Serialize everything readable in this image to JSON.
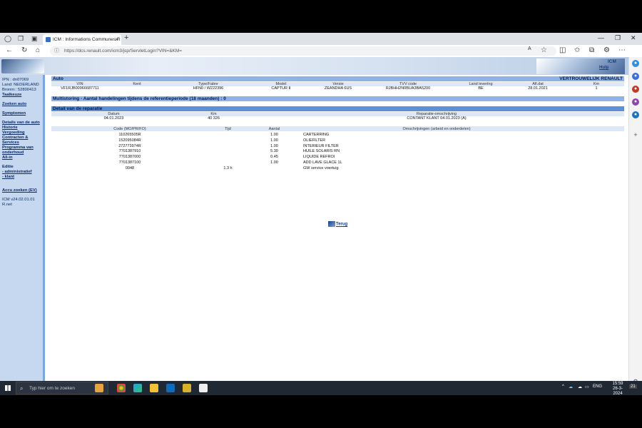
{
  "browser": {
    "tab_title": "ICM : Informations Communes R",
    "tab_close": "×",
    "new_tab": "+",
    "url": "https://dcs.renault.com/icm3/jsp/ServletLogin?VIN=&KM="
  },
  "header": {
    "icm": "ICM",
    "hulp": "Hulp",
    "confidential": "VERTROUWELIJK RENAULT"
  },
  "sidebar": {
    "ipn": "IPN : dn07069",
    "land": "Land: NEDERLAND",
    "bronnr": "Bronnr.: 52800413",
    "taalkeuze": "Taalkeuze",
    "zoeken_auto": "Zoeken auto",
    "symptomen": "Symptomen",
    "details": "Details van de auto",
    "historie": "Historie",
    "vergoeding": "Vergoeding",
    "contracten": "Contracten & Services",
    "programma": "Programma van onderhoud",
    "all_in": "All-in",
    "editie": "Editie",
    "administratief": "- administratief",
    "klant": "- klant",
    "accu": "Accu zoeken (EV)",
    "version": "ICM v24.02.01.01",
    "rnet": "R.net"
  },
  "auto": {
    "title": "Auto",
    "headers": [
      "VIN",
      "Kent",
      "Type/Fabnr",
      "Model",
      "Versie",
      "TVV code",
      "Land levering",
      "Afl.dat",
      "Km"
    ],
    "values": [
      "VF1RJB00966687711",
      "",
      "HFN0 / W222396",
      "CAPTUR II",
      "ZEANDHA 6US",
      "RJBHH2N0BUA3BA5200",
      "BE",
      "28.01.2021",
      "1"
    ]
  },
  "multistoring": "Multistoring - Aantal handelingen tijdens de referentieperiode (18 maanden) : 0",
  "repair": {
    "title": "Detail van de reparatie",
    "headers": [
      "Datum",
      "Km",
      "Reparatie-omschrijving"
    ],
    "values": [
      "04.01.2023",
      "40 326",
      "CONTANT KLANT 04.01.2023 (A)"
    ]
  },
  "parts": {
    "headers": [
      "Code (MO/PR/FO)",
      "Tijd",
      "Aantal",
      "Omschrijvingen (arbeid en onderdelen)"
    ],
    "rows": [
      {
        "code": "110265505R",
        "tijd": "",
        "aantal": "1.00",
        "desc": "CARTERRING"
      },
      {
        "code": "152095084R",
        "tijd": "",
        "aantal": "1.00",
        "desc": "OLIEFILTER"
      },
      {
        "code": "272773974R",
        "tijd": "",
        "aantal": "1.00",
        "desc": "INTERIEUR FILTER"
      },
      {
        "code": "7701387910",
        "tijd": "",
        "aantal": "5.30",
        "desc": "HUILE SOLARIS RN"
      },
      {
        "code": "7701387000",
        "tijd": "",
        "aantal": "0.45",
        "desc": "LIQUIDE REFROI"
      },
      {
        "code": "7701387100",
        "tijd": "",
        "aantal": "1.00",
        "desc": "ADD LAVE GLACE 1L"
      },
      {
        "code": "0048",
        "tijd": "1.3 h",
        "aantal": "",
        "desc": "GW service voertuig"
      }
    ]
  },
  "terug": "Terug",
  "taskbar": {
    "search_placeholder": "Typ hier om te zoeken",
    "lang": "ENG",
    "time": "15:59",
    "date": "26-3-2024",
    "notif": "21"
  }
}
